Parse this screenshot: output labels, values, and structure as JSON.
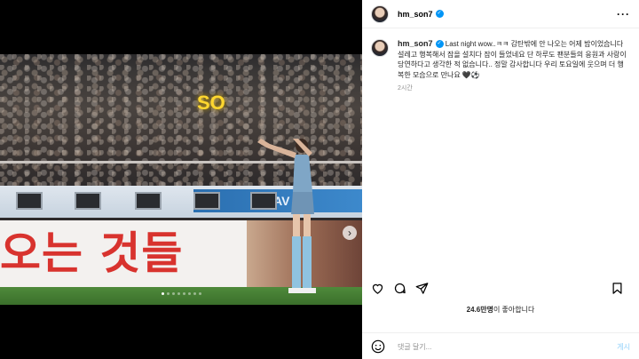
{
  "header": {
    "username": "hm_son7",
    "more_label": "···"
  },
  "caption": {
    "username": "hm_son7",
    "text": "Last night wow..ㅋㅋ 감탄밖에 안 나오는 어제 밤이었습니다 설레고 행복해서 잠을 설치다 잠이 들었네요 단 하루도 팬분들의 응원과 사랑이 당연하다고 생각한 적 없습니다.. 정말 감사합니다 우리 토요일에 웃으며 더 행복한 모습으로 만나요 🖤⚽",
    "time": "2시간"
  },
  "photo": {
    "adboard_text": "오는 것들",
    "led_text": "NAV",
    "crowd_sign": "SO"
  },
  "carousel": {
    "total_dots": 8,
    "active_index": 0
  },
  "likes": {
    "count": "24.6만명",
    "suffix": "이 좋아합니다"
  },
  "comment": {
    "placeholder": "댓글 달기...",
    "post_label": "게시"
  },
  "icons": [
    "heart-icon",
    "comment-icon",
    "share-icon",
    "bookmark-icon",
    "emoji-icon",
    "chevron-right-icon",
    "verified-icon",
    "more-icon"
  ],
  "colors": {
    "verified": "#0095f6",
    "post_button_disabled": "#b2dffc",
    "muted": "#8e8e8e"
  }
}
